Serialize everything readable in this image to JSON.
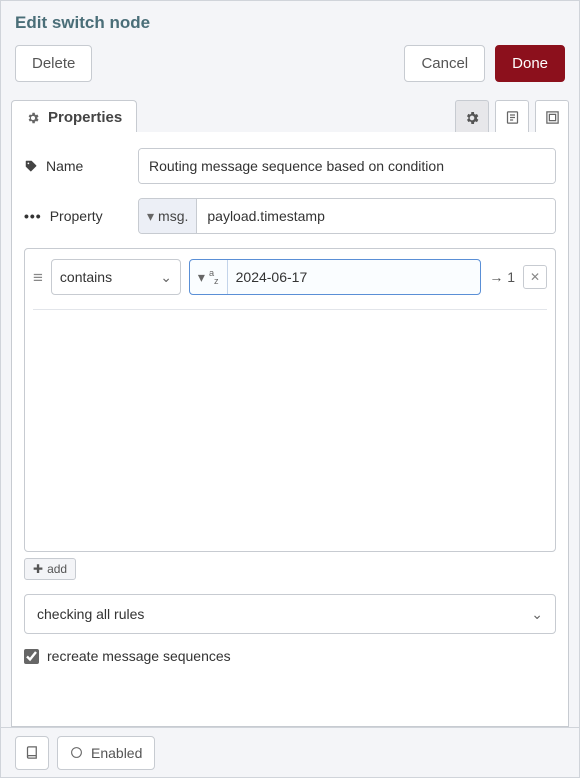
{
  "title": "Edit switch node",
  "buttons": {
    "delete": "Delete",
    "cancel": "Cancel",
    "done": "Done"
  },
  "tab": {
    "properties": "Properties"
  },
  "fields": {
    "name_label": "Name",
    "name_value": "Routing message sequence based on condition",
    "property_label": "Property",
    "property_scope": "msg.",
    "property_value": "payload.timestamp"
  },
  "rule": {
    "operator": "contains",
    "type_hint": "a-z",
    "value": "2024-06-17",
    "output": "→ 1"
  },
  "add_label": "add",
  "mode_select": "checking all rules",
  "recreate_label": "recreate message sequences",
  "recreate_checked": true,
  "footer_enabled": "Enabled"
}
